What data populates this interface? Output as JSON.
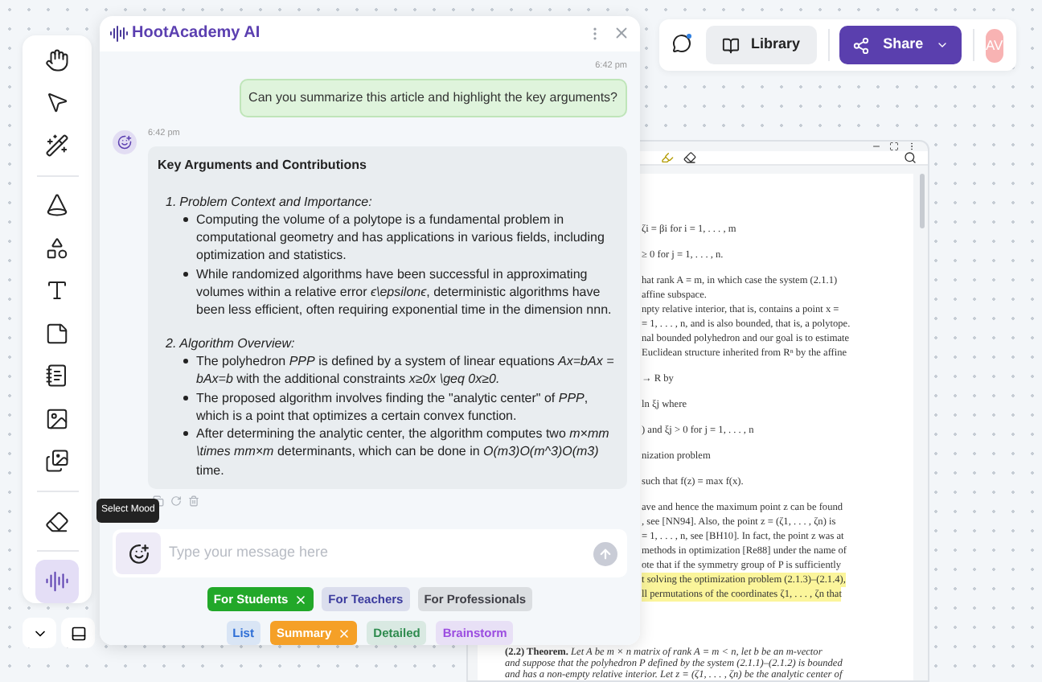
{
  "toolbar": {
    "groups": [
      {
        "tools": [
          {
            "selected": false
          },
          {
            "selected": false
          },
          {
            "selected": false
          }
        ]
      },
      {
        "tools": [
          {
            "selected": false
          },
          {
            "selected": false
          },
          {
            "selected": false
          },
          {
            "selected": false
          },
          {
            "selected": false
          },
          {
            "selected": false
          },
          {
            "selected": false
          }
        ]
      },
      {
        "tools": [
          {
            "selected": false
          }
        ]
      },
      {
        "tools": [
          {
            "selected": true
          }
        ]
      }
    ]
  },
  "top_bar": {
    "library": "Library",
    "share": "Share",
    "avatar": "AV"
  },
  "chat": {
    "title": "HootAcademy AI",
    "messages": [
      {
        "kind": "user",
        "time": "6:42 pm",
        "text": "Can you summarize this article and highlight the key arguments?"
      },
      {
        "kind": "assistant",
        "time": "6:42 pm",
        "heading": "Key Arguments and Contributions",
        "sections": [
          {
            "number": "1.",
            "title": "Problem Context and Importance:",
            "bullets": [
              "Computing the volume of a polytope is a fundamental problem in computational geometry and has applications in various fields, including optimization and statistics.",
              "While randomized algorithms have been successful in approximating volumes within a relative error *ϵ\\epsilonϵ*, deterministic algorithms have been less efficient, often requiring exponential time in the dimension nnn."
            ]
          },
          {
            "number": "2.",
            "title": "Algorithm Overview:",
            "bullets": [
              "The polyhedron *PPP* is defined by a system of linear equations *Ax=bAx = bAx=b* with the additional constraints *x≥0x \\geq 0x≥0.*",
              "The proposed algorithm involves finding the \"analytic center\" of *PPP*, which is a point that optimizes a certain convex function.",
              "After determining the analytic center, the algorithm computes two *m×mm \\times mm×m* determinants, which can be done in *O(m3)O(m^3)O(m3)* time."
            ]
          }
        ]
      }
    ],
    "tooltip": "Select Mood",
    "input": {
      "placeholder": "Type your message here"
    },
    "audience_chips": [
      {
        "label": "For Students",
        "selected": true,
        "color": "#22a829"
      },
      {
        "label": "For Teachers",
        "selected": false,
        "color": "#3b3b9e"
      },
      {
        "label": "For Professionals",
        "selected": false,
        "color": "#3f3f46"
      }
    ],
    "style_chips": [
      {
        "label": "List",
        "selected": false,
        "color": "#2f6fd6"
      },
      {
        "label": "Summary",
        "selected": true,
        "color": "#f5a027"
      },
      {
        "label": "Detailed",
        "selected": false,
        "color": "#2e8b4e"
      },
      {
        "label": "Brainstorm",
        "selected": false,
        "color": "#9b4de0"
      }
    ]
  },
  "document": {
    "paragraphs": [
      [
        {
          "text": "ζi = βi    for    i = 1, . . . , m",
          "highlighted": false
        }
      ],
      [
        {
          "text": "≥ 0    for    j = 1, . . . , n.",
          "highlighted": false
        }
      ],
      [
        {
          "text": "hat rank A = m, in which case the system (2.1.1)",
          "highlighted": false
        },
        {
          "text": "affine subspace.",
          "highlighted": false
        },
        {
          "text": "npty relative interior, that is, contains a point x =",
          "highlighted": false
        },
        {
          "text": "= 1, . . . , n, and is also bounded, that is, a polytope.",
          "highlighted": false
        },
        {
          "text": "nal bounded polyhedron and our goal is to estimate",
          "highlighted": false
        },
        {
          "text": "Euclidean structure inherited from Rⁿ by the affine",
          "highlighted": false
        }
      ],
      [
        {
          "text": "→ R by",
          "highlighted": false
        }
      ],
      [
        {
          "text": "ln ξj    where",
          "highlighted": false
        }
      ],
      [
        {
          "text": ")    and    ξj > 0    for    j = 1, . . . , n",
          "highlighted": false
        }
      ],
      [
        {
          "text": "nization problem",
          "highlighted": false
        }
      ],
      [
        {
          "text": "such that    f(z) = max f(x).",
          "highlighted": false
        }
      ],
      [
        {
          "text": "ave and hence the maximum point z can be found",
          "highlighted": false
        },
        {
          "text": ", see [NN94]. Also, the point z = (ζ1, . . . , ζn) is",
          "highlighted": false
        },
        {
          "text": "= 1, . . . , n, see [BH10]. In fact, the point z was at",
          "highlighted": false
        },
        {
          "text": "methods in optimization [Re88] under the name of",
          "highlighted": false
        },
        {
          "text": "ote that if the symmetry group of P is sufficiently",
          "highlighted": false
        },
        {
          "text": "t solving the optimization problem (2.1.3)–(2.1.4),",
          "highlighted": true
        },
        {
          "text": "ll permutations of the coordinates ζ1, . . . , ζn that",
          "highlighted": true
        }
      ]
    ],
    "theorem_lines": [
      "**(2.2) Theorem.** *Let A be m × n matrix of rank A = m < n, let b be an m-vector*",
      "*and suppose that the polyhedron P defined by the system (2.1.1)–(2.1.2) is bounded*",
      "*and has a non-empty relative interior. Let z = (ζ1, . . . , ζn) be the analytic center of*"
    ]
  }
}
